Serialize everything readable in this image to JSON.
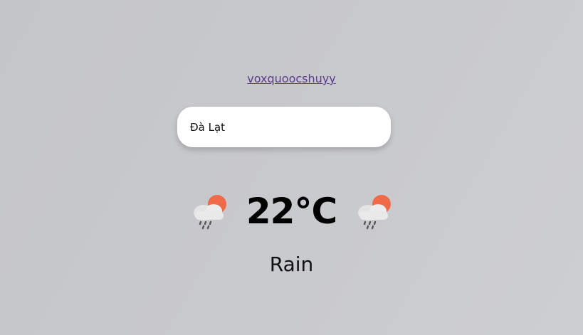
{
  "author": {
    "link_text": "voxquoocshuyy"
  },
  "search": {
    "value": "Đà Lạt"
  },
  "weather": {
    "temperature": "22°C",
    "condition": "Rain",
    "icon_left": "cloud-sun-rain-icon",
    "icon_right": "cloud-sun-rain-icon"
  },
  "colors": {
    "background": "#c8c9cc",
    "link": "#5d3a8c",
    "sun": "#ef6a48",
    "cloud": "#e6e6e6",
    "rain": "#555555"
  }
}
